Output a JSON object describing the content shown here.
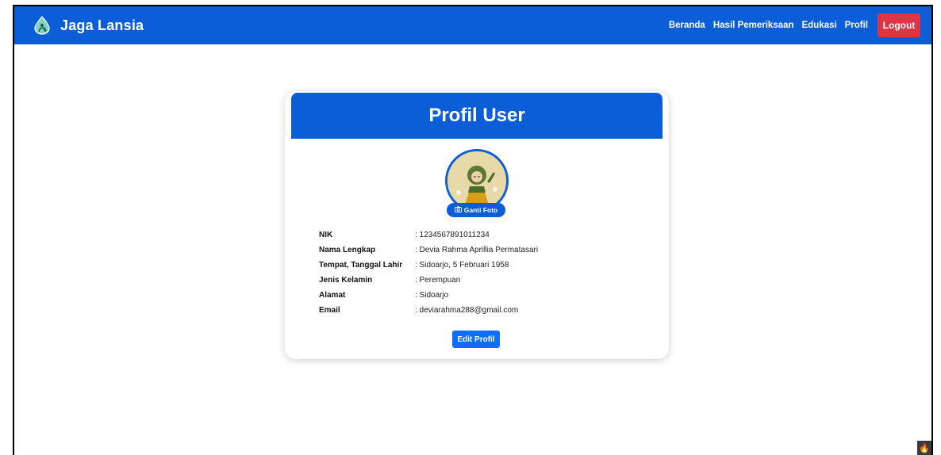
{
  "brand": {
    "name": "Jaga Lansia",
    "logo_icon": "water-drop-elder-icon"
  },
  "nav": {
    "links": [
      "Beranda",
      "Hasil Pemeriksaan",
      "Edukasi",
      "Profil"
    ],
    "logout_label": "Logout"
  },
  "card": {
    "title": "Profil User",
    "change_photo_label": "Ganti Foto",
    "fields": [
      {
        "label": "NIK",
        "value": ": 1234567891011234"
      },
      {
        "label": "Nama Lengkap",
        "value": ": Devia Rahma Aprillia Permatasari"
      },
      {
        "label": "Tempat, Tanggal Lahir",
        "value": ": Sidoarjo, 5 Februari 1958"
      },
      {
        "label": "Jenis Kelamin",
        "value": ": Perempuan"
      },
      {
        "label": "Alamat",
        "value": ": Sidoarjo"
      },
      {
        "label": "Email",
        "value": ": deviarahma288@gmail.com"
      }
    ],
    "edit_label": "Edit Profil"
  },
  "colors": {
    "primary": "#0b5ed7",
    "danger": "#dc3545",
    "button": "#0d6efd"
  }
}
